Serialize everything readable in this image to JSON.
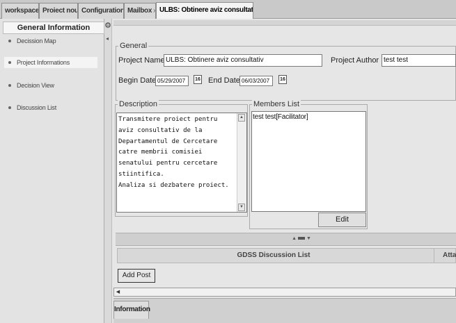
{
  "tabs": [
    {
      "label": "workspace",
      "closable": false,
      "active": false
    },
    {
      "label": "Proiect nou",
      "closable": true,
      "active": false
    },
    {
      "label": "Configuration",
      "closable": true,
      "active": false
    },
    {
      "label": "Mailbox",
      "closable": true,
      "active": false
    },
    {
      "label": "ULBS: Obtinere aviz consultativ",
      "closable": true,
      "active": true
    }
  ],
  "tab_close_glyph": "x",
  "sidebar": {
    "header": "General Information",
    "items": [
      {
        "label": "Decission Map",
        "selected": false
      },
      {
        "label": "Project Informations",
        "selected": true
      },
      {
        "label": "Decision View",
        "selected": false
      },
      {
        "label": "Discussion List",
        "selected": false
      }
    ]
  },
  "general": {
    "legend": "General",
    "project_name_label": "Project Name",
    "project_name_value": "ULBS: Obtinere aviz consultativ",
    "project_author_label": "Project Author",
    "project_author_value": "test test",
    "begin_date_label": "Begin Date",
    "begin_date_value": "05/29/2007",
    "end_date_label": "End Date",
    "end_date_value": "06/03/2007",
    "calendar_icon_text": "16"
  },
  "description": {
    "legend": "Description",
    "text": "Transmitere proiect pentru\naviz consultativ de la\nDepartamentul de Cercetare\ncatre membrii comisiei\nsenatului pentru cercetare\nstiintifica.\nAnaliza si dezbatere proiect."
  },
  "members": {
    "legend": "Members List",
    "items": [
      "test test[Facilitator]"
    ],
    "edit_label": "Edit"
  },
  "discussion": {
    "title": "GDSS Discussion List",
    "second_column": "Attac",
    "add_post_label": "Add Post"
  },
  "bottom_tabs": [
    {
      "label": "Information",
      "active": true
    }
  ],
  "colors": {
    "tab_strip": "#c9c9c9",
    "panel_bg": "#e6e6e6",
    "sidebar_bg": "#e3e3e3"
  }
}
